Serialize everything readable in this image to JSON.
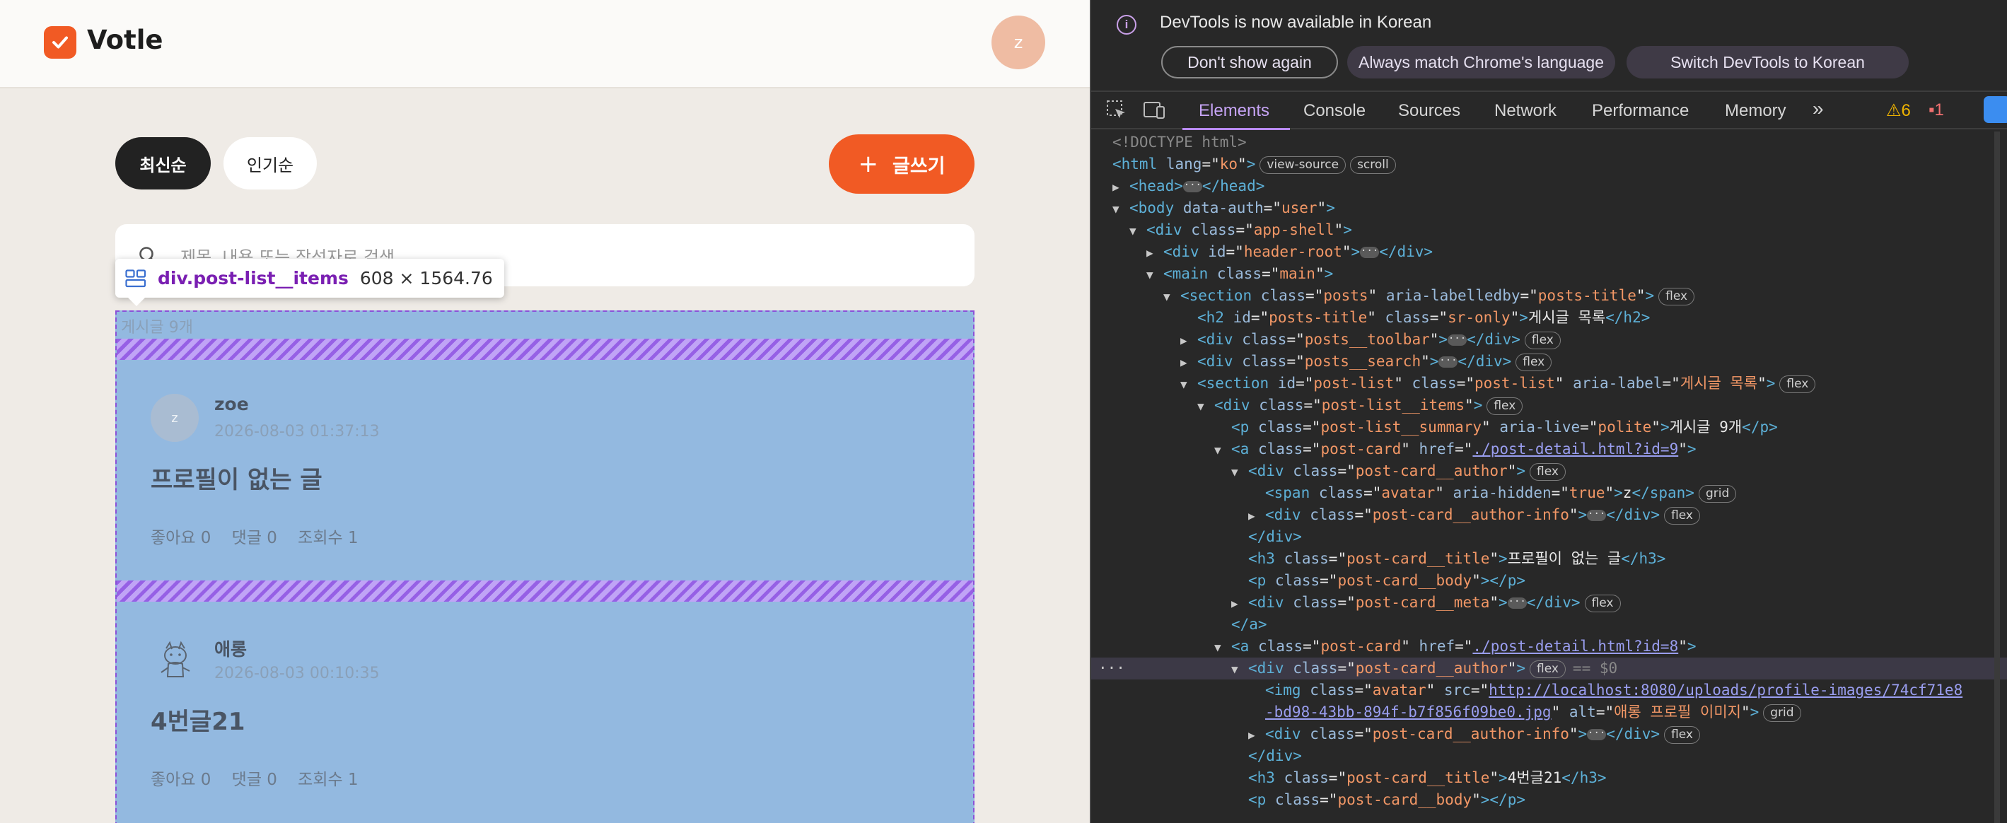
{
  "app": {
    "logo_text": "Votle",
    "header_avatar": "z",
    "sort": {
      "latest": "최신순",
      "popular": "인기순"
    },
    "write_button": {
      "icon": "+",
      "label": "글쓰기"
    },
    "search_placeholder": "제목, 내용 또는 작성자로 검색",
    "inspect_tooltip": {
      "name": "div.post-list__items",
      "size": "608 × 1564.76"
    },
    "list_summary": "게시글 9개",
    "posts": [
      {
        "avatar": "z",
        "author": "zoe",
        "date": "2026-08-03 01:37:13",
        "title": "프로필이 없는 글",
        "meta": "좋아요 0    댓글 0    조회수 1"
      },
      {
        "avatar_icon": "character-sketch-icon",
        "author": "애롱",
        "date": "2026-08-03 00:10:35",
        "title": "4번글21",
        "meta": "좋아요 0    댓글 0    조회수 1"
      }
    ],
    "colors": {
      "accent": "#f15a24",
      "highlight": "#78aade",
      "gap": "#9650e6"
    }
  },
  "devtools": {
    "infobar": {
      "message": "DevTools is now available in Korean",
      "buttons": [
        "Don't show again",
        "Always match Chrome's language",
        "Switch DevTools to Korean"
      ]
    },
    "tabs": [
      "Elements",
      "Console",
      "Sources",
      "Network",
      "Performance",
      "Memory"
    ],
    "more_tabs": "»",
    "warnings": "6",
    "errors": "1",
    "dom": {
      "doctype": "<!DOCTYPE html>",
      "html_lang": "ko",
      "badge_view_source": "view-source",
      "badge_scroll": "scroll",
      "body_auth": "user",
      "shell_class": "app-shell",
      "header_id": "header-root",
      "main_class": "main",
      "section_class": "posts",
      "section_labelledby": "posts-title",
      "h2_id": "posts-title",
      "h2_class": "sr-only",
      "h2_text": "게시글 목록",
      "toolbar_class": "posts__toolbar",
      "search_class": "posts__search",
      "list_id": "post-list",
      "list_class": "post-list",
      "list_label": "게시글 목록",
      "items_class": "post-list__items",
      "summary_class": "post-list__summary",
      "summary_live": "polite",
      "summary_text": "게시글 9개",
      "card_class": "post-card",
      "card1_href": "./post-detail.html?id=9",
      "author_class": "post-card__author",
      "avatar_class": "avatar",
      "avatar_hidden": "true",
      "avatar_text": "z",
      "author_info_class": "post-card__author-info",
      "title_class": "post-card__title",
      "card1_title": "프로필이 없는 글",
      "body_class": "post-card__body",
      "meta_class": "post-card__meta",
      "card2_href": "./post-detail.html?id=8",
      "sel_suffix": "== $0",
      "img_src_1": "http://localhost:8080/uploads/profile-images/74cf71e8",
      "img_src_2": "-bd98-43bb-894f-b7f856f09be0.jpg",
      "img_alt": "애롱 프로필 이미지",
      "card2_title": "4번글21",
      "badge_flex": "flex",
      "badge_grid": "grid"
    }
  }
}
